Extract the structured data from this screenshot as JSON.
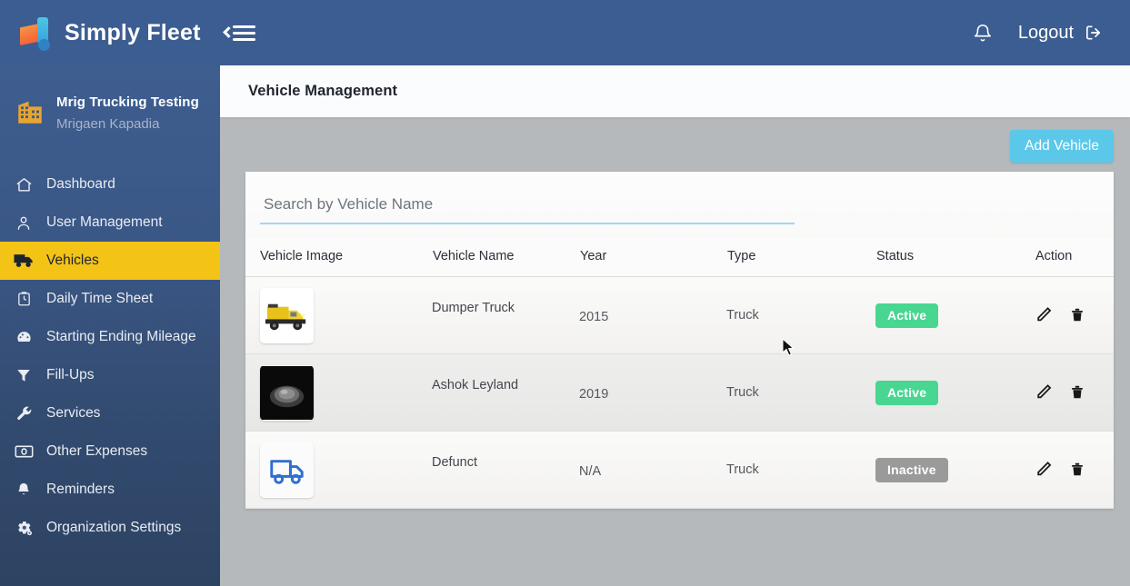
{
  "header": {
    "brand": "Simply Fleet",
    "menu_toggle_icon": "hamburger-collapse-icon",
    "notification_icon": "bell-icon",
    "logout_label": "Logout",
    "logout_icon": "sign-out-icon",
    "background_color": "#3c5d91"
  },
  "sidebar": {
    "org_icon": "building-icon",
    "org_name": "Mrig Trucking Testing",
    "org_user": "Mrigaen Kapadia",
    "active_item_color": "#f3c316",
    "items": [
      {
        "label": "Dashboard",
        "icon": "home-icon",
        "active": false
      },
      {
        "label": "User Management",
        "icon": "user-icon",
        "active": false
      },
      {
        "label": "Vehicles",
        "icon": "truck-icon",
        "active": true
      },
      {
        "label": "Daily Time Sheet",
        "icon": "clipboard-icon",
        "active": false
      },
      {
        "label": "Starting Ending Mileage",
        "icon": "gauge-icon",
        "active": false
      },
      {
        "label": "Fill-Ups",
        "icon": "funnel-icon",
        "active": false
      },
      {
        "label": "Services",
        "icon": "wrench-icon",
        "active": false
      },
      {
        "label": "Other Expenses",
        "icon": "banknote-icon",
        "active": false
      },
      {
        "label": "Reminders",
        "icon": "bell-icon",
        "active": false
      },
      {
        "label": "Organization Settings",
        "icon": "gears-icon",
        "active": false
      }
    ]
  },
  "main": {
    "page_title": "Vehicle Management",
    "add_button_label": "Add Vehicle",
    "add_button_color": "#5bc8ea",
    "search": {
      "placeholder": "Search by Vehicle Name",
      "value": ""
    },
    "table": {
      "columns": [
        "Vehicle Image",
        "Vehicle Name",
        "Year",
        "Type",
        "Status",
        "Action"
      ],
      "rows": [
        {
          "image": "yellow-dump-truck-photo",
          "name": "Dumper Truck",
          "year": "2015",
          "type": "Truck",
          "status": "Active",
          "status_color": "#48d691",
          "edit_icon": "pencil-icon",
          "delete_icon": "trash-icon"
        },
        {
          "image": "dark-truck-photo",
          "name": "Ashok Leyland",
          "year": "2019",
          "type": "Truck",
          "status": "Active",
          "status_color": "#48d691",
          "edit_icon": "pencil-icon",
          "delete_icon": "trash-icon"
        },
        {
          "image": "blue-truck-outline-icon",
          "name": "Defunct",
          "year": "N/A",
          "type": "Truck",
          "status": "Inactive",
          "status_color": "#9a9a9a",
          "edit_icon": "pencil-icon",
          "delete_icon": "trash-icon"
        }
      ]
    }
  }
}
